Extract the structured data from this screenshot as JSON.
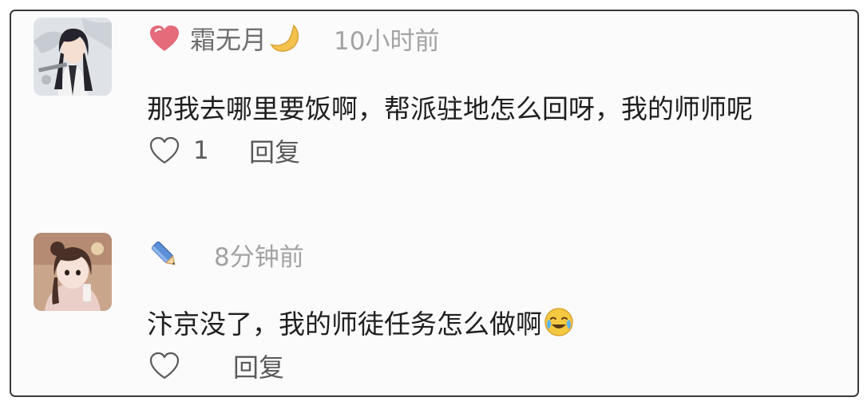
{
  "comments": [
    {
      "username": "霜无月",
      "badge_icon": "heart-icon",
      "suffix_icon": "crescent-moon-icon",
      "timestamp": "10小时前",
      "content": "那我去哪里要饭啊，帮派驻地怎么回呀，我的师师呢",
      "like_count": "1",
      "reply_label": "回复"
    },
    {
      "username": "",
      "badge_icon": "pencil-icon",
      "timestamp": "8分钟前",
      "content": "汴京没了，我的师徒任务怎么做啊",
      "content_emoji": "crying-laughing-emoji",
      "like_count": "",
      "reply_label": "回复"
    }
  ],
  "colors": {
    "heart": "#e56a7a",
    "moon": "#f3c24d",
    "pencil": "#5b8fd8",
    "frame_border": "#3a3a3a",
    "text": "#1f1f1f",
    "meta": "#a3a3a3"
  }
}
